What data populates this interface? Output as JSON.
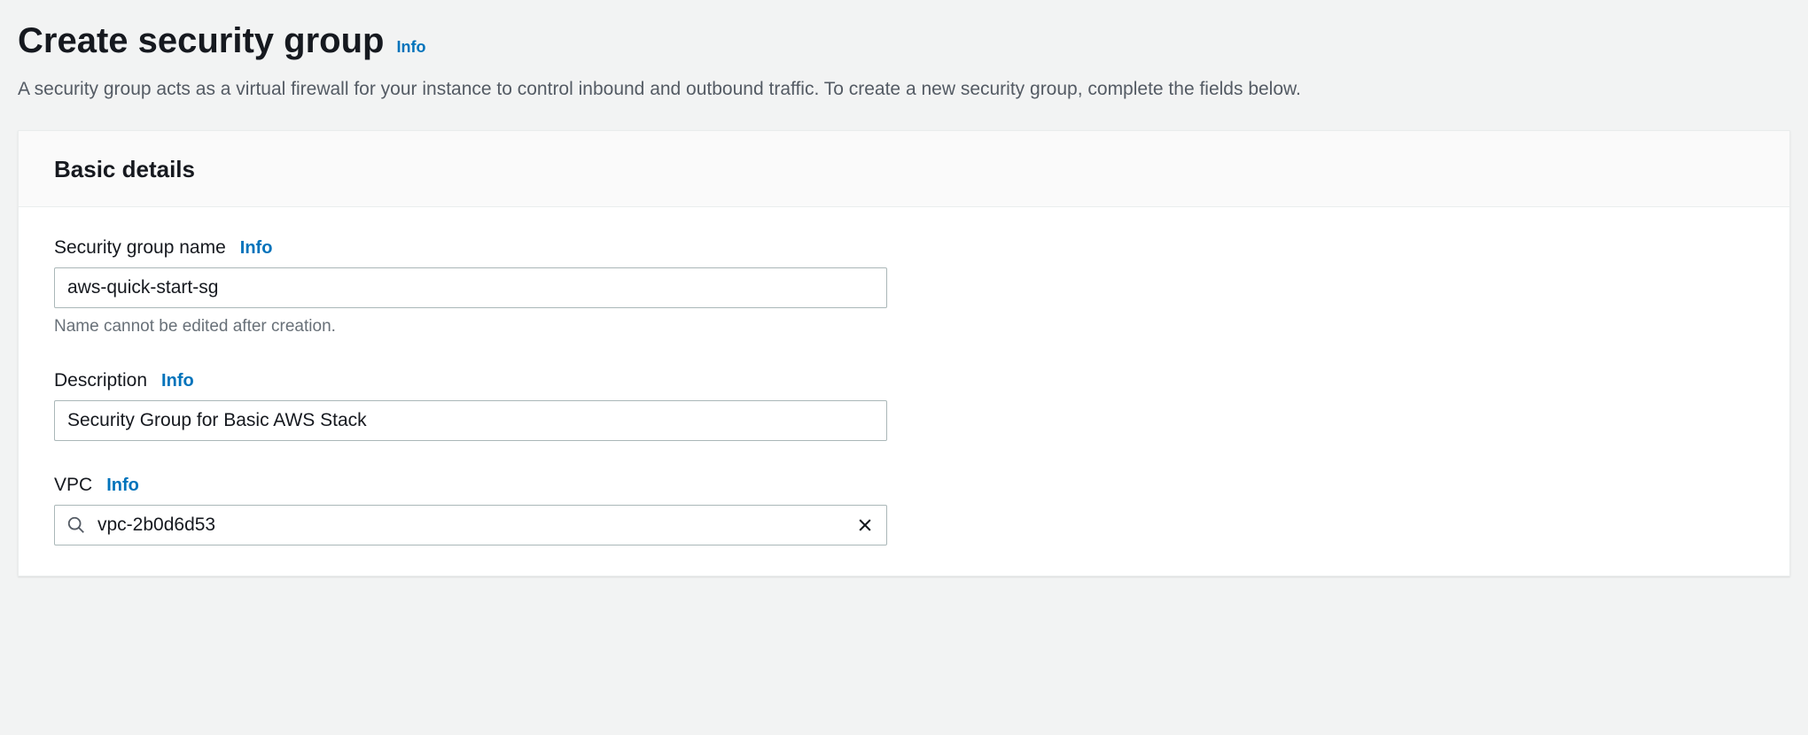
{
  "header": {
    "title": "Create security group",
    "info_label": "Info",
    "description": "A security group acts as a virtual firewall for your instance to control inbound and outbound traffic. To create a new security group, complete the fields below."
  },
  "panel": {
    "title": "Basic details",
    "fields": {
      "security_group_name": {
        "label": "Security group name",
        "info_label": "Info",
        "value": "aws-quick-start-sg",
        "helper": "Name cannot be edited after creation."
      },
      "description": {
        "label": "Description",
        "info_label": "Info",
        "value": "Security Group for Basic AWS Stack"
      },
      "vpc": {
        "label": "VPC",
        "info_label": "Info",
        "value": "vpc-2b0d6d53"
      }
    }
  }
}
